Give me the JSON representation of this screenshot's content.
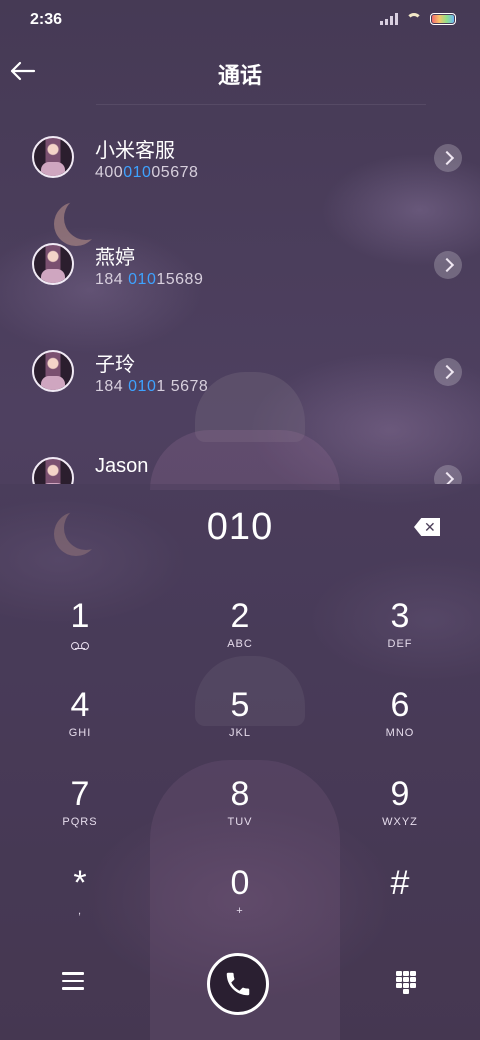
{
  "status_bar": {
    "time": "2:36"
  },
  "header": {
    "title": "通话"
  },
  "results": [
    {
      "name": "小米客服",
      "number_parts": [
        "400",
        "010",
        "05678"
      ]
    },
    {
      "name": "燕婷",
      "number_parts": [
        "184 ",
        "010",
        "15689"
      ]
    },
    {
      "name": "子玲",
      "number_parts": [
        "184 ",
        "010",
        "1 5678"
      ]
    },
    {
      "name": "Jason",
      "number_parts": [
        "",
        "",
        ""
      ]
    }
  ],
  "dialer": {
    "typed_number": "010",
    "keys": [
      {
        "digit": "1",
        "sub": ""
      },
      {
        "digit": "2",
        "sub": "ABC"
      },
      {
        "digit": "3",
        "sub": "DEF"
      },
      {
        "digit": "4",
        "sub": "GHI"
      },
      {
        "digit": "5",
        "sub": "JKL"
      },
      {
        "digit": "6",
        "sub": "MNO"
      },
      {
        "digit": "7",
        "sub": "PQRS"
      },
      {
        "digit": "8",
        "sub": "TUV"
      },
      {
        "digit": "9",
        "sub": "WXYZ"
      },
      {
        "digit": "*",
        "sub": ","
      },
      {
        "digit": "0",
        "sub": "+"
      },
      {
        "digit": "#",
        "sub": ""
      }
    ]
  },
  "colors": {
    "highlight": "#3ea2ff",
    "background": "#4b3e58"
  }
}
